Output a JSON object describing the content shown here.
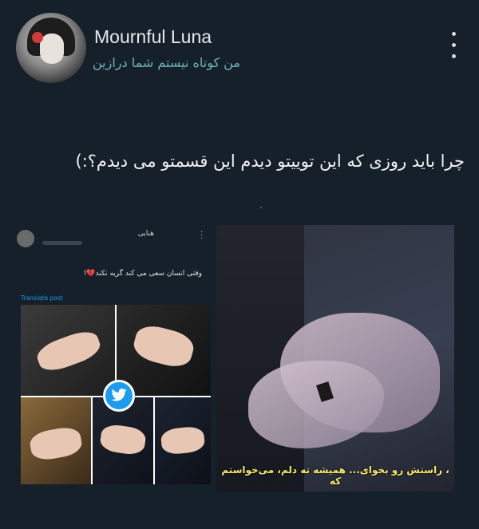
{
  "header": {
    "name": "Mournful Luna",
    "handle": "من کوتاه نیستم شما درازین"
  },
  "tweet": {
    "text": "چرا باید روزی که این توییتو دیدم این قسمتو می دیدم؟:)"
  },
  "embedded_screenshot": {
    "name": "هنایی",
    "text": "وقتی انسان سعی می کند گریه نکند💔!",
    "translate": "Translate post"
  },
  "video_frame": {
    "subtitle": "، راستش رو بخوای... همیشه ته دلم، می‌خواستم که"
  },
  "colors": {
    "background": "#15202b",
    "handle": "#6fb3b8",
    "subtitle": "#f5e66a",
    "twitter_blue": "#1d9bf0"
  }
}
